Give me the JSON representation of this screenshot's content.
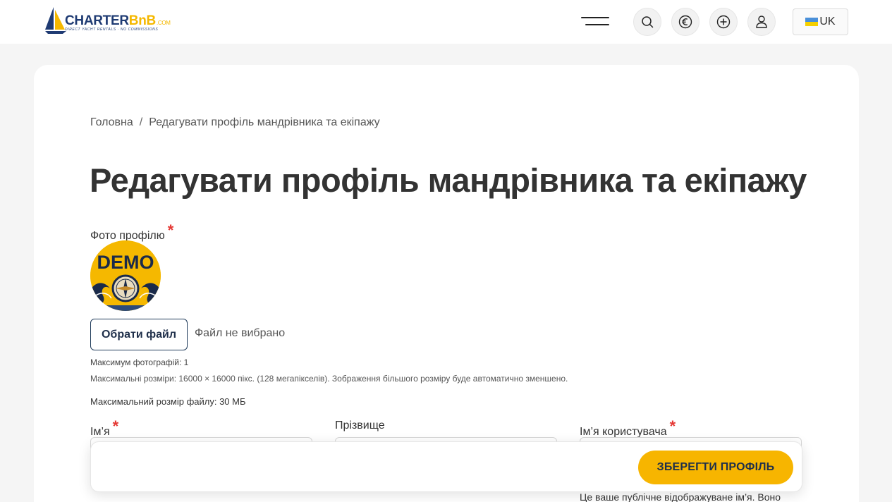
{
  "header": {
    "logo_text_main": "CHARTER",
    "logo_text_bnb": "BnB",
    "logo_text_com": ".COM",
    "logo_tagline": "DIRECT YACHT RENTALS · NO COMMISSIONS",
    "language_label": "UK",
    "icons": [
      "menu-icon",
      "search-icon",
      "currency-euro-icon",
      "add-icon",
      "user-icon",
      "flag-ukraine-icon"
    ]
  },
  "breadcrumb": {
    "home": "Головна",
    "separator": "/",
    "current": "Редагувати профіль мандрівника та екіпажу"
  },
  "page_title": "Редагувати профіль мандрівника та екіпажу",
  "profile_photo": {
    "label": "Фото профілю",
    "required_mark": "*",
    "avatar_text": "DEMO",
    "choose_file_label": "Обрати файл",
    "file_status": "Файл не вибрано",
    "max_photos": "Максимум фотографій: 1",
    "max_dimensions": "Максимальні розміри: 16000 × 16000 пікс. (128 мегапікселів). Зображення більшого розміру буде автоматично зменшено.",
    "max_file_size": "Максимальний розмір файлу: 30 МБ"
  },
  "fields": {
    "first_name": {
      "label": "Ім’я",
      "required_mark": "*",
      "value": ""
    },
    "last_name": {
      "label": "Прізвище",
      "value": ""
    },
    "username": {
      "label": "Ім’я користувача",
      "required_mark": "*",
      "value": ""
    }
  },
  "username_note": "Це ваше публічне відображуване ім’я. Воно",
  "save_button_label": "ЗБЕРЕГТИ ПРОФІЛЬ",
  "colors": {
    "accent": "#f7b500",
    "brand_navy": "#1f3b73",
    "required": "#e53935"
  }
}
